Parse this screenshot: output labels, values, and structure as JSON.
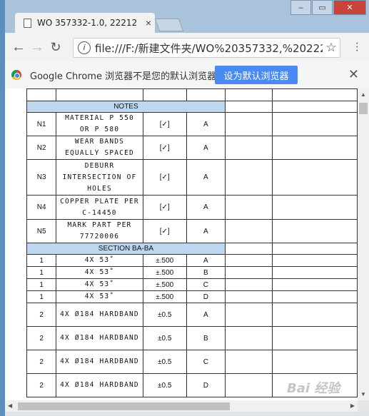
{
  "browser": {
    "tab_title": "WO 357332-1.0, 22212",
    "tab_close": "×",
    "address": "file:///F:/新建文件夹/WO%20357332,%202221...",
    "window_buttons": [
      "–",
      "▭",
      "✕"
    ]
  },
  "infobar": {
    "message": "Google Chrome 浏览器不是您的默认浏览器。",
    "button": "设为默认浏览器",
    "close": "✕"
  },
  "document": {
    "notes_header": "NOTES",
    "notes": [
      {
        "id": "N1",
        "desc": [
          "MATERIAL  P 550",
          "OR P 580"
        ],
        "check": "[✓]",
        "grade": "A"
      },
      {
        "id": "N2",
        "desc": [
          "WEAR BANDS",
          "EQUALLY SPACED"
        ],
        "check": "[✓]",
        "grade": "A"
      },
      {
        "id": "N3",
        "desc": [
          "DEBURR",
          "INTERSECTION OF",
          "HOLES"
        ],
        "check": "[✓]",
        "grade": "A"
      },
      {
        "id": "N4",
        "desc": [
          "COPPER PLATE PER",
          "C-14450"
        ],
        "check": "[✓]",
        "grade": "A"
      },
      {
        "id": "N5",
        "desc": [
          "MARK PART PER",
          "77720006"
        ],
        "check": "[✓]",
        "grade": "A"
      }
    ],
    "section_header": "SECTION BA-BA",
    "section_rows": [
      {
        "qty": "1",
        "desc": "4X 53˚",
        "tol": "±.500",
        "grade": "A"
      },
      {
        "qty": "1",
        "desc": "4X 53˚",
        "tol": "±.500",
        "grade": "B"
      },
      {
        "qty": "1",
        "desc": "4X 53˚",
        "tol": "±.500",
        "grade": "C"
      },
      {
        "qty": "1",
        "desc": "4X 53˚",
        "tol": "±.500",
        "grade": "D"
      },
      {
        "qty": "2",
        "desc": "4X Ø184 HARDBAND",
        "tol": "±0.5",
        "grade": "A"
      },
      {
        "qty": "2",
        "desc": "4X Ø184 HARDBAND",
        "tol": "±0.5",
        "grade": "B"
      },
      {
        "qty": "2",
        "desc": "4X Ø184 HARDBAND",
        "tol": "±0.5",
        "grade": "C"
      },
      {
        "qty": "2",
        "desc": "4X Ø184 HARDBAND",
        "tol": "±0.5",
        "grade": "D"
      }
    ]
  },
  "watermark": "Bai 经验"
}
